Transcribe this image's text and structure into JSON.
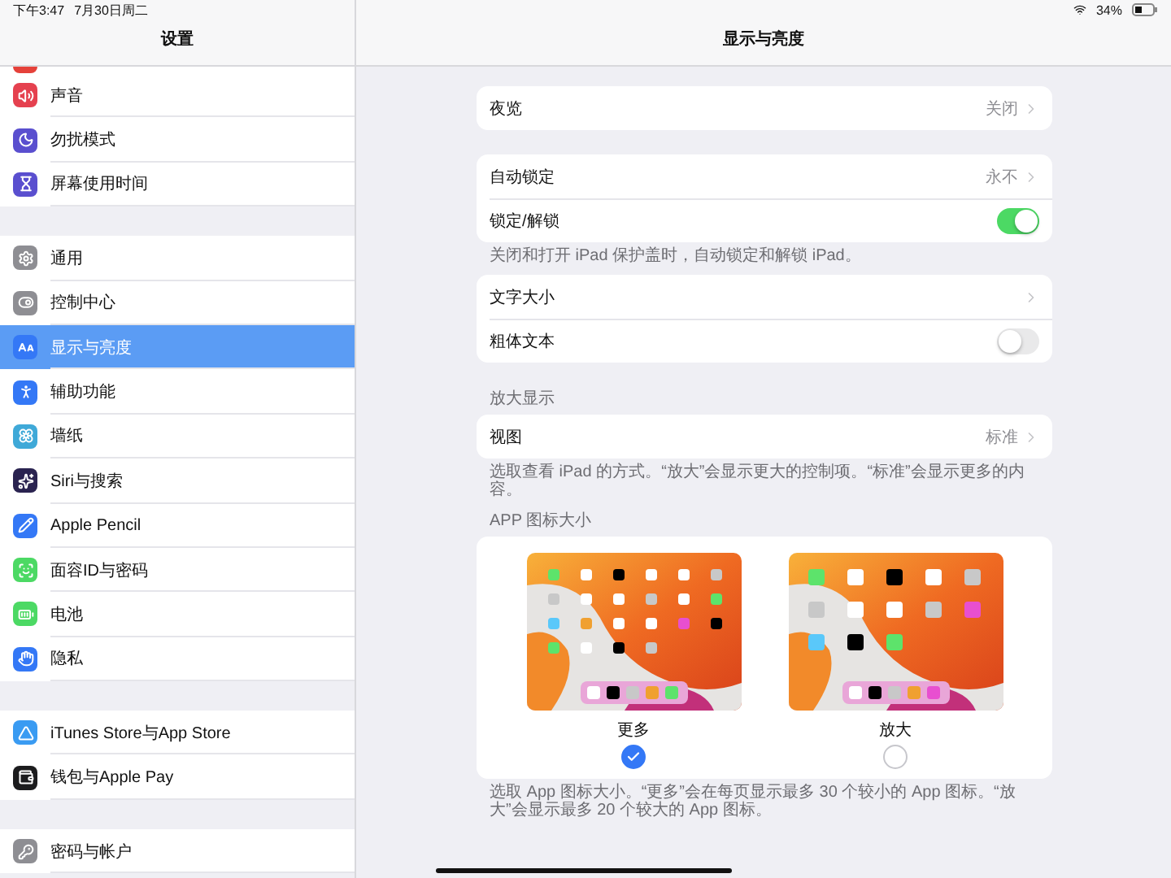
{
  "status_bar": {
    "time": "下午3:47",
    "date": "7月30日周二",
    "battery": "34%"
  },
  "sidebar": {
    "title": "设置",
    "groups": [
      [
        {
          "color": "#e5413a"
        },
        {
          "label": "声音",
          "color": "#e5414f",
          "selected": false
        },
        {
          "label": "勿扰模式",
          "color": "#5a4fcf",
          "selected": false
        },
        {
          "label": "屏幕使用时间",
          "color": "#5a4fcf",
          "selected": false
        }
      ],
      [
        {
          "label": "通用",
          "color": "#8e8e93",
          "selected": false
        },
        {
          "label": "控制中心",
          "color": "#8e8e93",
          "selected": false
        },
        {
          "label": "显示与亮度",
          "color": "#3478f6",
          "selected": true
        },
        {
          "label": "辅助功能",
          "color": "#3478f6",
          "selected": false
        },
        {
          "label": "墙纸",
          "color": "#3fa9d8",
          "selected": false
        },
        {
          "label": "Siri与搜索",
          "color": "#2a2350",
          "selected": false
        },
        {
          "label": "Apple Pencil",
          "color": "#3478f6",
          "selected": false
        },
        {
          "label": "面容ID与密码",
          "color": "#4cd964",
          "selected": false
        },
        {
          "label": "电池",
          "color": "#4cd964",
          "selected": false
        },
        {
          "label": "隐私",
          "color": "#3478f6",
          "selected": false
        }
      ],
      [
        {
          "label": "iTunes Store与App Store",
          "color": "#3a9bf2",
          "selected": false
        },
        {
          "label": "钱包与Apple Pay",
          "color": "#1c1c1e",
          "selected": false
        }
      ],
      [
        {
          "label": "密码与帐户",
          "color": "#8e8e93",
          "selected": false
        }
      ]
    ]
  },
  "main": {
    "title": "显示与亮度",
    "sections": [
      {
        "rows": [
          {
            "kind": "disclosure",
            "label": "夜览",
            "value": "关闭"
          }
        ]
      },
      {
        "rows": [
          {
            "kind": "disclosure",
            "label": "自动锁定",
            "value": "永不"
          },
          {
            "kind": "toggle",
            "label": "锁定/解锁",
            "on": true
          }
        ],
        "footer": "关闭和打开 iPad 保护盖时，自动锁定和解锁 iPad。"
      },
      {
        "rows": [
          {
            "kind": "disclosure",
            "label": "文字大小"
          },
          {
            "kind": "toggle",
            "label": "粗体文本",
            "on": false
          }
        ]
      },
      {
        "header": "放大显示",
        "rows": [
          {
            "kind": "disclosure",
            "label": "视图",
            "value": "标准"
          }
        ],
        "footer": "选取查看 iPad 的方式。“放大”会显示更大的控制项。“标准”会显示更多的内容。"
      },
      {
        "header": "APP 图标大小",
        "icon_options": [
          {
            "label": "更多",
            "selected": true
          },
          {
            "label": "放大",
            "selected": false
          }
        ],
        "footer": "选取 App 图标大小。“更多”会在每页显示最多 30 个较小的 App 图标。“放大”会显示最多 20 个较大的 App 图标。"
      }
    ]
  }
}
